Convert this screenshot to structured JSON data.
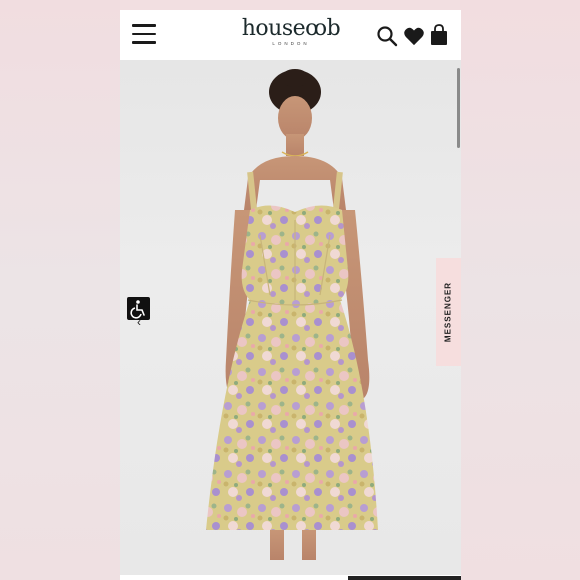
{
  "brand": {
    "name": "house of cb",
    "logo_text": "houseꝏb",
    "sub_text": "LONDON"
  },
  "header": {
    "menu_icon": "hamburger-icon",
    "search_icon": "search-icon",
    "wishlist_icon": "heart-icon",
    "bag_icon": "shopping-bag-icon"
  },
  "side_tab": {
    "label": "MESSENGER"
  },
  "accessibility": {
    "icon": "wheelchair-icon",
    "arrow": "‹"
  },
  "product_image": {
    "alt": "Model wearing floral midi dress with corset bodice",
    "dress_colors": [
      "#dccc86",
      "#b79bd0",
      "#e8c3c3",
      "#9bb38a"
    ]
  },
  "colors": {
    "header_bg": "#ffffff",
    "accent_dark": "#1c2a2c",
    "messenger_bg": "#f6dede"
  }
}
